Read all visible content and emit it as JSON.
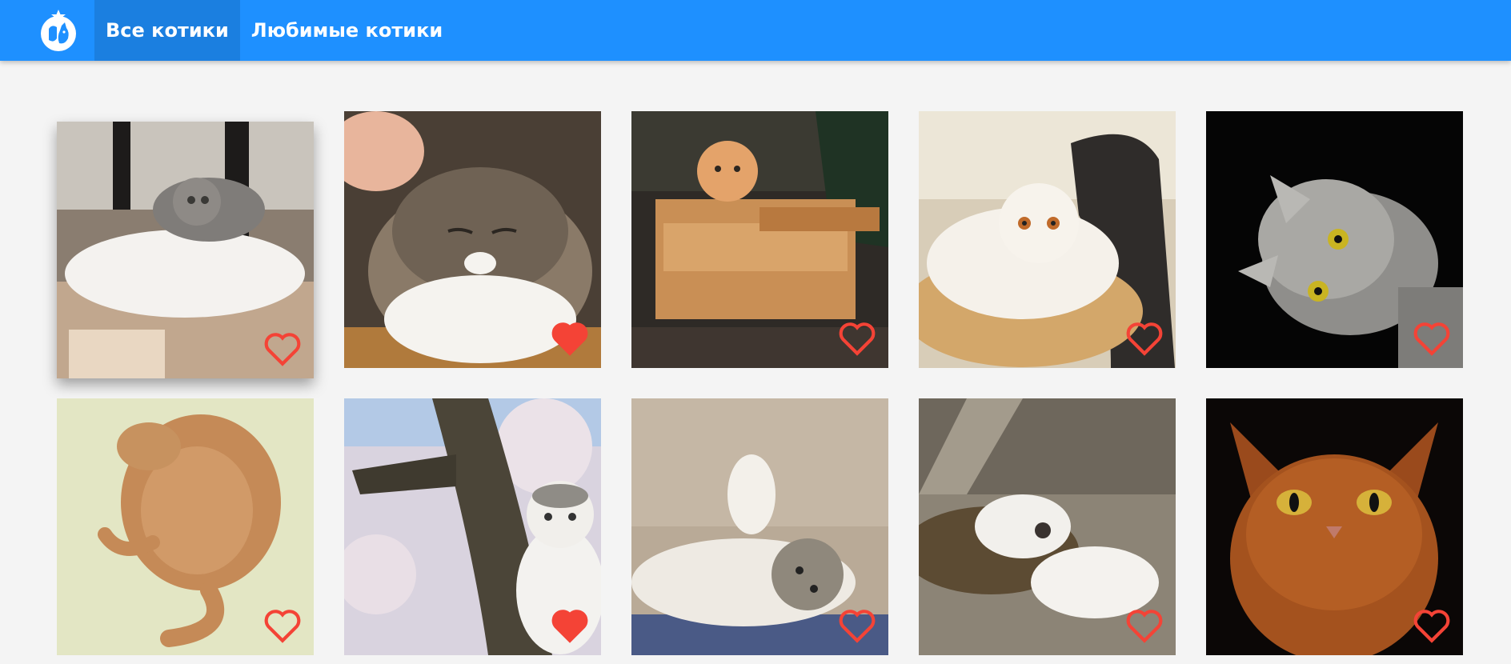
{
  "header": {
    "logo_icon": "cat-dog-logo-icon",
    "tabs": [
      {
        "label": "Все котики",
        "active": true
      },
      {
        "label": "Любимые котики",
        "active": false
      }
    ],
    "colors": {
      "bar": "#1e90ff",
      "active_tab": "#1b7fe0",
      "text": "#ffffff"
    }
  },
  "cats": [
    {
      "description": "grey-white kitten lying on white cat",
      "favorited": false,
      "heart_icon": "heart-outline-icon"
    },
    {
      "description": "tabby scottish fold being petted",
      "favorited": true,
      "heart_icon": "heart-filled-icon"
    },
    {
      "description": "ginger kitten in cardboard tank",
      "favorited": false,
      "heart_icon": "heart-outline-icon"
    },
    {
      "description": "white scottish fold on chair",
      "favorited": false,
      "heart_icon": "heart-outline-icon"
    },
    {
      "description": "grey tabby cat on black background",
      "favorited": false,
      "heart_icon": "heart-outline-icon"
    },
    {
      "description": "ginger cat sleeping on mat",
      "favorited": false,
      "heart_icon": "heart-outline-icon"
    },
    {
      "description": "white-grey cat in blossom tree",
      "favorited": true,
      "heart_icon": "heart-filled-icon"
    },
    {
      "description": "fluffy cat lying on back",
      "favorited": false,
      "heart_icon": "heart-outline-icon"
    },
    {
      "description": "cat paws on carpet",
      "favorited": false,
      "heart_icon": "heart-outline-icon"
    },
    {
      "description": "somali cat portrait",
      "favorited": false,
      "heart_icon": "heart-outline-icon"
    }
  ],
  "heart_color": "#f44336"
}
